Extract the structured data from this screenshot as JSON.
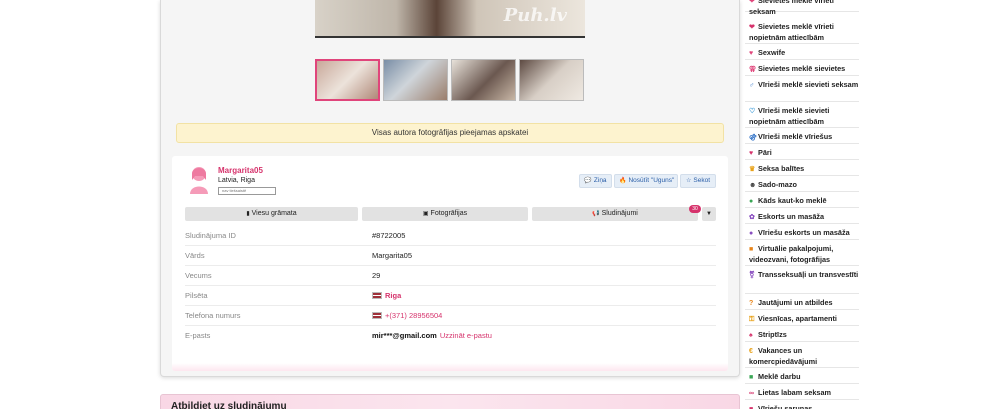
{
  "gallery": {
    "watermark": "Puh.lv",
    "thumbnails": [
      "thumb-1",
      "thumb-2",
      "thumb-3",
      "thumb-4"
    ],
    "active_thumb": 0
  },
  "notice": {
    "text": "Visas autora fotogrāfijas pieejamas apskatei"
  },
  "profile": {
    "name": "Margarita05",
    "location": "Latvia, Riga",
    "status": "nav tiešsaistē",
    "actions": {
      "write": "Ziņa",
      "fire": "Nosūtīt \"Uguns\"",
      "follow": "Sekot"
    },
    "tabs": {
      "guestbook": "Viesu grāmata",
      "photos": "Fotogrāfijas",
      "ads": "Sludinājumi",
      "ads_count": "30"
    },
    "fields": {
      "id_label": "Sludinājuma ID",
      "id_value": "#8722005",
      "name_label": "Vārds",
      "name_value": "Margarita05",
      "age_label": "Vecums",
      "age_value": "29",
      "city_label": "Pilsēta",
      "city_value": "Riga",
      "phone_label": "Telefona numurs",
      "phone_value": "+(371) 28956504",
      "email_label": "E-pasts",
      "email_value": "mir***@gmail.com",
      "email_reveal": "Uzzināt e-pastu"
    }
  },
  "reply": {
    "title": "Atbildiet uz sludinājumu"
  },
  "colors": {
    "accent": "#d6336c",
    "notice_bg": "#fdf3cf",
    "button_text": "#2a5ea8"
  },
  "sidebar": {
    "items": [
      {
        "icon": "heart-icon",
        "glyph": "❤",
        "color": "#e0457b",
        "label": "Sievietes meklē vīrieti seksam"
      },
      {
        "icon": "heart-icon",
        "glyph": "❤",
        "color": "#d6336c",
        "label": "Sievietes meklē vīrieti nopietnām attiecībām"
      },
      {
        "icon": "heart-icon",
        "glyph": "♥",
        "color": "#e0457b",
        "label": "Sexwife"
      },
      {
        "icon": "female-couple-icon",
        "glyph": "⚢",
        "color": "#e0457b",
        "label": "Sievietes meklē sievietes"
      },
      {
        "icon": "male-icon",
        "glyph": "♂",
        "color": "#3a78c9",
        "label": "Vīrieši meklē sievieti seksam"
      },
      {
        "icon": "heart-outline-icon",
        "glyph": "♡",
        "color": "#3a9ad9",
        "label": "Vīrieši meklē sievieti nopietnām attiecībām"
      },
      {
        "icon": "male-couple-icon",
        "glyph": "⚣",
        "color": "#3a78c9",
        "label": "Vīrieši meklē vīriešus"
      },
      {
        "icon": "couple-hearts-icon",
        "glyph": "♥",
        "color": "#d6336c",
        "label": "Pāri"
      },
      {
        "icon": "ballet-icon",
        "glyph": "♛",
        "color": "#e8a21a",
        "label": "Seksa balītes"
      },
      {
        "icon": "mask-icon",
        "glyph": "☻",
        "color": "#444444",
        "label": "Sado-mazo"
      },
      {
        "icon": "search-icon",
        "glyph": "●",
        "color": "#3aa655",
        "label": "Kāds kaut-ko meklē"
      },
      {
        "icon": "lotus-icon",
        "glyph": "✿",
        "color": "#8a4fc0",
        "label": "Eskorts un masāža"
      },
      {
        "icon": "user-icon",
        "glyph": "●",
        "color": "#8a4fc0",
        "label": "Vīriešu eskorts un masāža"
      },
      {
        "icon": "camera-icon",
        "glyph": "■",
        "color": "#e8851a",
        "label": "Virtuālie pakalpojumi, videozvani, fotogrāfijas"
      },
      {
        "icon": "transgender-icon",
        "glyph": "⚧",
        "color": "#8a4fc0",
        "label": "Transseksuāļi un transvestīti"
      },
      {
        "icon": "question-icon",
        "glyph": "?",
        "color": "#e8851a",
        "label": "Jautājumi un atbildes"
      },
      {
        "icon": "key-icon",
        "glyph": "⚿",
        "color": "#e8a21a",
        "label": "Viesnīcas, apartamenti"
      },
      {
        "icon": "striptease-icon",
        "glyph": "♠",
        "color": "#d6336c",
        "label": "Striptīzs"
      },
      {
        "icon": "euro-icon",
        "glyph": "€",
        "color": "#e8a21a",
        "label": "Vakances un komercpiedāvājumi"
      },
      {
        "icon": "briefcase-icon",
        "glyph": "■",
        "color": "#3aa655",
        "label": "Meklē darbu"
      },
      {
        "icon": "glasses-icon",
        "glyph": "∞",
        "color": "#d6336c",
        "label": "Lietas labam seksam"
      },
      {
        "icon": "gift-icon",
        "glyph": "■",
        "color": "#d6336c",
        "label": "Vīriešu sarunas"
      }
    ]
  }
}
